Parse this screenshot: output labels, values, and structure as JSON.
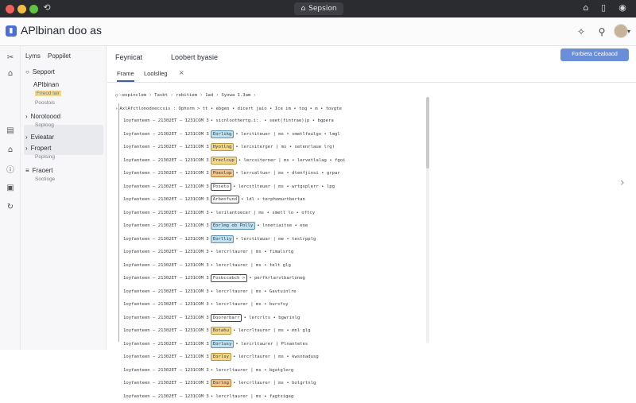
{
  "window": {
    "tab_title": "Sepsion"
  },
  "app": {
    "title": "APlbinan doo as"
  },
  "rail_icons": [
    "tools-icon",
    "home-icon",
    "server-icon",
    "globe-icon",
    "info-icon",
    "widget-icon",
    "sync-icon"
  ],
  "sidebar": {
    "tabs": [
      "Lyms",
      "Poppilet"
    ],
    "items": [
      {
        "label": "Sepport",
        "sub": ""
      },
      {
        "label": "APlbinan",
        "sub": "Frieod lair"
      },
      {
        "label": "",
        "sub": "Poostois"
      },
      {
        "label": "Norotoood",
        "sub": "Soploog"
      },
      {
        "label": "Evieatar",
        "sub": ""
      },
      {
        "label": "Fropert",
        "sub": "Poplsing"
      },
      {
        "label": "Fraoert",
        "sub": "Soctioge"
      }
    ]
  },
  "main": {
    "tabs": [
      "Feynicat",
      "Loobert byasie"
    ],
    "primary_button": "Forbieta Cealoaod",
    "subtabs": [
      "Frame",
      "Loolslleg"
    ],
    "header_line": "‹eopinclem › Tasbt › robitiem › 1ad › Syowa    1.3am ›",
    "root_line": "AxlAfctlonodoeccsis : Ophorm > tt • ebgen • dicert jaio • Ice im • tog • m • tovgte",
    "log_prefix": "1oyfanteen — 21302ET — 1231COM 3",
    "rows": [
      {
        "tag": "",
        "tail": "• sicnloothertg.i:. • seet(fintrae)|p • bgpera"
      },
      {
        "tag": "Eorlikg",
        "tail": "• lerctiteuer | ms • smetlfeulgo • lmgl"
      },
      {
        "tag": "Hyotlng",
        "tail": "• lercsiterger | ms • setenrlaue lrg)"
      },
      {
        "tag": "Preclcup",
        "tail": "• lercsiterner | ms • lervetlalag • fgoi"
      },
      {
        "tag": "Poeslop",
        "tail": "• lerrcaltuer | ms • dtenfjinsi • grpar"
      },
      {
        "tag": "Poseto",
        "tail": "• lercstlteuer | ms • wrtgsplerr • lpg"
      },
      {
        "tag": "Arbenfund",
        "tail": "• ldl • terphomurtbertan"
      },
      {
        "tag": "",
        "tail": "• lerilantoecer | ms • smetl lo • oftcy"
      },
      {
        "tag": "Eorlmg ob Polly",
        "tail": "• lnnetiaitse • eoe"
      },
      {
        "tag": "Eorlliy",
        "tail": "• lerctitauar | me • teslrpplg"
      },
      {
        "tag": "",
        "tail": "• lercrltaurer | ms • fimalsrtg"
      },
      {
        "tag": "",
        "tail": "• lercrltaurer | ms • telt glg"
      },
      {
        "tag": "Fosbccabch >",
        "tail": "• perfkrlarvtbarloneg"
      },
      {
        "tag": "",
        "tail": "• lercrltaurer | ms • Gavtuinlre"
      },
      {
        "tag": "",
        "tail": "• lercrltaurer | ms • bursfsy"
      },
      {
        "tag": "Doorerbarr",
        "tail": "• lercrlts • bgwrinlg"
      },
      {
        "tag": "Botahu",
        "tail": "• lercrltaurer | ms • mnl glg"
      },
      {
        "tag": "Eorlusy",
        "tail": "• lercrltaurer | Plnantetes"
      },
      {
        "tag": "Eorlsy",
        "tail": "• lercrltaurer | ms • kwsonadusg"
      },
      {
        "tag": "",
        "tail": "• lercrltaurer | ms • bgatglerg"
      },
      {
        "tag": "Eorlng",
        "tail": "• lercrltaurer | ms • bolgrtnlg"
      },
      {
        "tag": "",
        "tail": "• lercrltaurer | ms • fagtsigeg"
      }
    ],
    "tag_colors": [
      "",
      "b",
      "y",
      "y",
      "o",
      "w",
      "w",
      "",
      "b",
      "b",
      "",
      "",
      "w",
      "",
      "",
      "w",
      "y",
      "b",
      "y",
      "",
      "o",
      ""
    ]
  }
}
